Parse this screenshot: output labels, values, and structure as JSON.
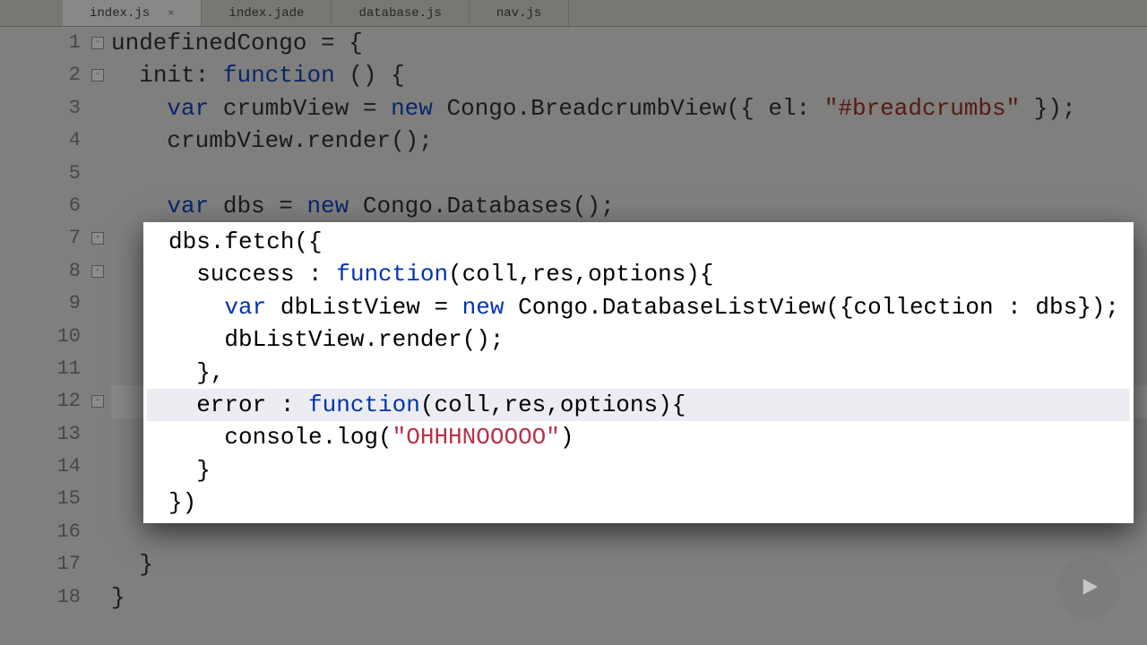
{
  "tabs": [
    {
      "label": "index.js",
      "active": true,
      "closable": true
    },
    {
      "label": "index.jade",
      "active": false,
      "closable": false
    },
    {
      "label": "database.js",
      "active": false,
      "closable": false
    },
    {
      "label": "nav.js",
      "active": false,
      "closable": false
    }
  ],
  "line_count": 18,
  "code": {
    "l1": {
      "tokens": [
        "Congo = {"
      ]
    },
    "l2": {
      "indent": "  ",
      "tokens": [
        "init",
        ": ",
        "function",
        " () {"
      ]
    },
    "l3": {
      "indent": "    ",
      "tokens": [
        "var",
        " crumbView = ",
        "new",
        " Congo.BreadcrumbView({ el: ",
        "\"#breadcrumbs\"",
        " });"
      ]
    },
    "l4": {
      "indent": "    ",
      "tokens": [
        "crumbView.render();"
      ]
    },
    "l5": {
      "indent": "",
      "tokens": [
        ""
      ]
    },
    "l6": {
      "indent": "    ",
      "tokens": [
        "var",
        " dbs = ",
        "new",
        " Congo.Databases();"
      ]
    },
    "l7": {
      "indent": "    ",
      "tokens": [
        "dbs.fetch({"
      ]
    },
    "l8": {
      "indent": "      ",
      "tokens": [
        "success : ",
        "function",
        "(coll,res,options){"
      ]
    },
    "l9": {
      "indent": "        ",
      "tokens": [
        "var",
        " dbListView = ",
        "new",
        " Congo.DatabaseListView({collection : dbs});"
      ]
    },
    "l10": {
      "indent": "        ",
      "tokens": [
        "dbListView.render();"
      ]
    },
    "l11": {
      "indent": "      ",
      "tokens": [
        "},"
      ]
    },
    "l12": {
      "indent": "      ",
      "tokens": [
        "error : ",
        "function",
        "(coll,res,options){"
      ]
    },
    "l13": {
      "indent": "        ",
      "tokens": [
        "console.log(",
        "\"OHHHNOOOOO\"",
        ")"
      ]
    },
    "l14": {
      "indent": "      ",
      "tokens": [
        "}"
      ]
    },
    "l15": {
      "indent": "    ",
      "tokens": [
        "})"
      ]
    },
    "l16": {
      "indent": "",
      "tokens": [
        ""
      ]
    },
    "l17": {
      "indent": "  ",
      "tokens": [
        "}"
      ]
    },
    "l18": {
      "indent": "",
      "tokens": [
        "}"
      ]
    }
  },
  "highlight": {
    "start": 7,
    "end": 15,
    "cursor_line": 12
  },
  "folds": [
    1,
    2,
    7,
    8,
    12
  ],
  "play_label": "play"
}
